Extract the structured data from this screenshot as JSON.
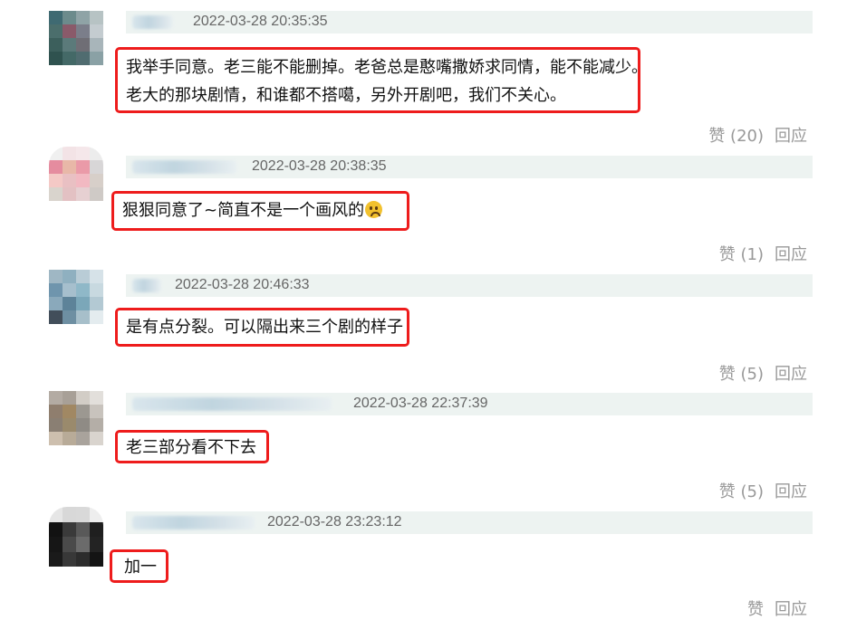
{
  "comments": [
    {
      "time": "2022-03-28 20:35:35",
      "lines": [
        "我举手同意。老三能不能删掉。老爸总是憨嘴撒娇求同情，能不能减少。",
        "老大的那块剧情，和谁都不搭噶，另外开剧吧，我们不关心。"
      ],
      "like_label": "赞 (20)",
      "reply_label": "回应"
    },
    {
      "time": "2022-03-28 20:38:35",
      "lines": [
        "狠狠同意了~简直不是一个画风的"
      ],
      "emoji": "sad-face-emoji",
      "like_label": "赞 (1)",
      "reply_label": "回应"
    },
    {
      "time": "2022-03-28 20:46:33",
      "lines": [
        "是有点分裂。可以隔出来三个剧的样子"
      ],
      "like_label": "赞 (5)",
      "reply_label": "回应"
    },
    {
      "time": "2022-03-28 22:37:39",
      "lines": [
        "老三部分看不下去"
      ],
      "like_label": "赞 (5)",
      "reply_label": "回应"
    },
    {
      "time": "2022-03-28 23:23:12",
      "lines": [
        "加一"
      ],
      "like_label": "赞",
      "reply_label": "回应"
    }
  ],
  "colors": {
    "highlight_border": "#ee1c1c",
    "meta_bar": "#edf3f1",
    "action_text": "#999999"
  }
}
